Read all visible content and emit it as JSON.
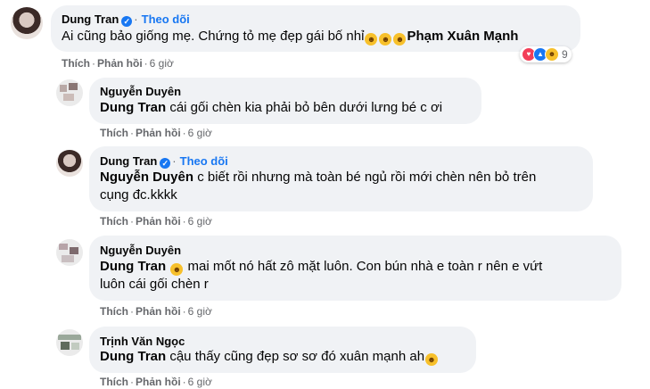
{
  "comments": [
    {
      "author": "Dung Tran",
      "follow_label": "Theo dõi",
      "text": "Ai cũng bảo giống mẹ. Chứng tỏ mẹ đẹp gái bố nhỉ",
      "mention": "Phạm Xuân Mạnh",
      "like_label": "Thích",
      "reply_label": "Phản hồi",
      "time": "6 giờ",
      "reaction_count": "9"
    },
    {
      "author": "Nguyễn Duyên",
      "mention": "Dung Tran",
      "text": "cái gối chèn kia phải bỏ bên dưới lưng bé c ơi",
      "like_label": "Thích",
      "reply_label": "Phản hồi",
      "time": "6 giờ"
    },
    {
      "author": "Dung Tran",
      "follow_label": "Theo dõi",
      "mention": "Nguyễn Duyên",
      "text_line1": "c biết rồi nhưng mà toàn bé ngủ rồi mới chèn nên bỏ trên",
      "text_line2": "cụng đc.kkkk",
      "like_label": "Thích",
      "reply_label": "Phản hồi",
      "time": "6 giờ"
    },
    {
      "author": "Nguyễn Duyên",
      "mention": "Dung Tran",
      "text_line1": "mai mốt nó hất zô mặt luôn. Con bún nhà e toàn r nên e vứt",
      "text_line2": "luôn cái gối chèn r",
      "like_label": "Thích",
      "reply_label": "Phản hồi",
      "time": "6 giờ"
    },
    {
      "author": "Trịnh Văn Ngọc",
      "mention": "Dung Tran",
      "text": "cậu thấy cũng đẹp sơ sơ đó xuân mạnh ah",
      "like_label": "Thích",
      "reply_label": "Phản hồi",
      "time": "6 giờ"
    }
  ],
  "icons": {
    "verified": "verified-badge-icon",
    "laugh_emoji": "rolling-laughing-emoji-icon",
    "reactions": [
      "love-reaction-icon",
      "like-reaction-icon",
      "haha-reaction-icon"
    ]
  },
  "colors": {
    "link_blue": "#1877f2",
    "bubble": "#f0f2f5",
    "meta_gray": "#65676b"
  }
}
